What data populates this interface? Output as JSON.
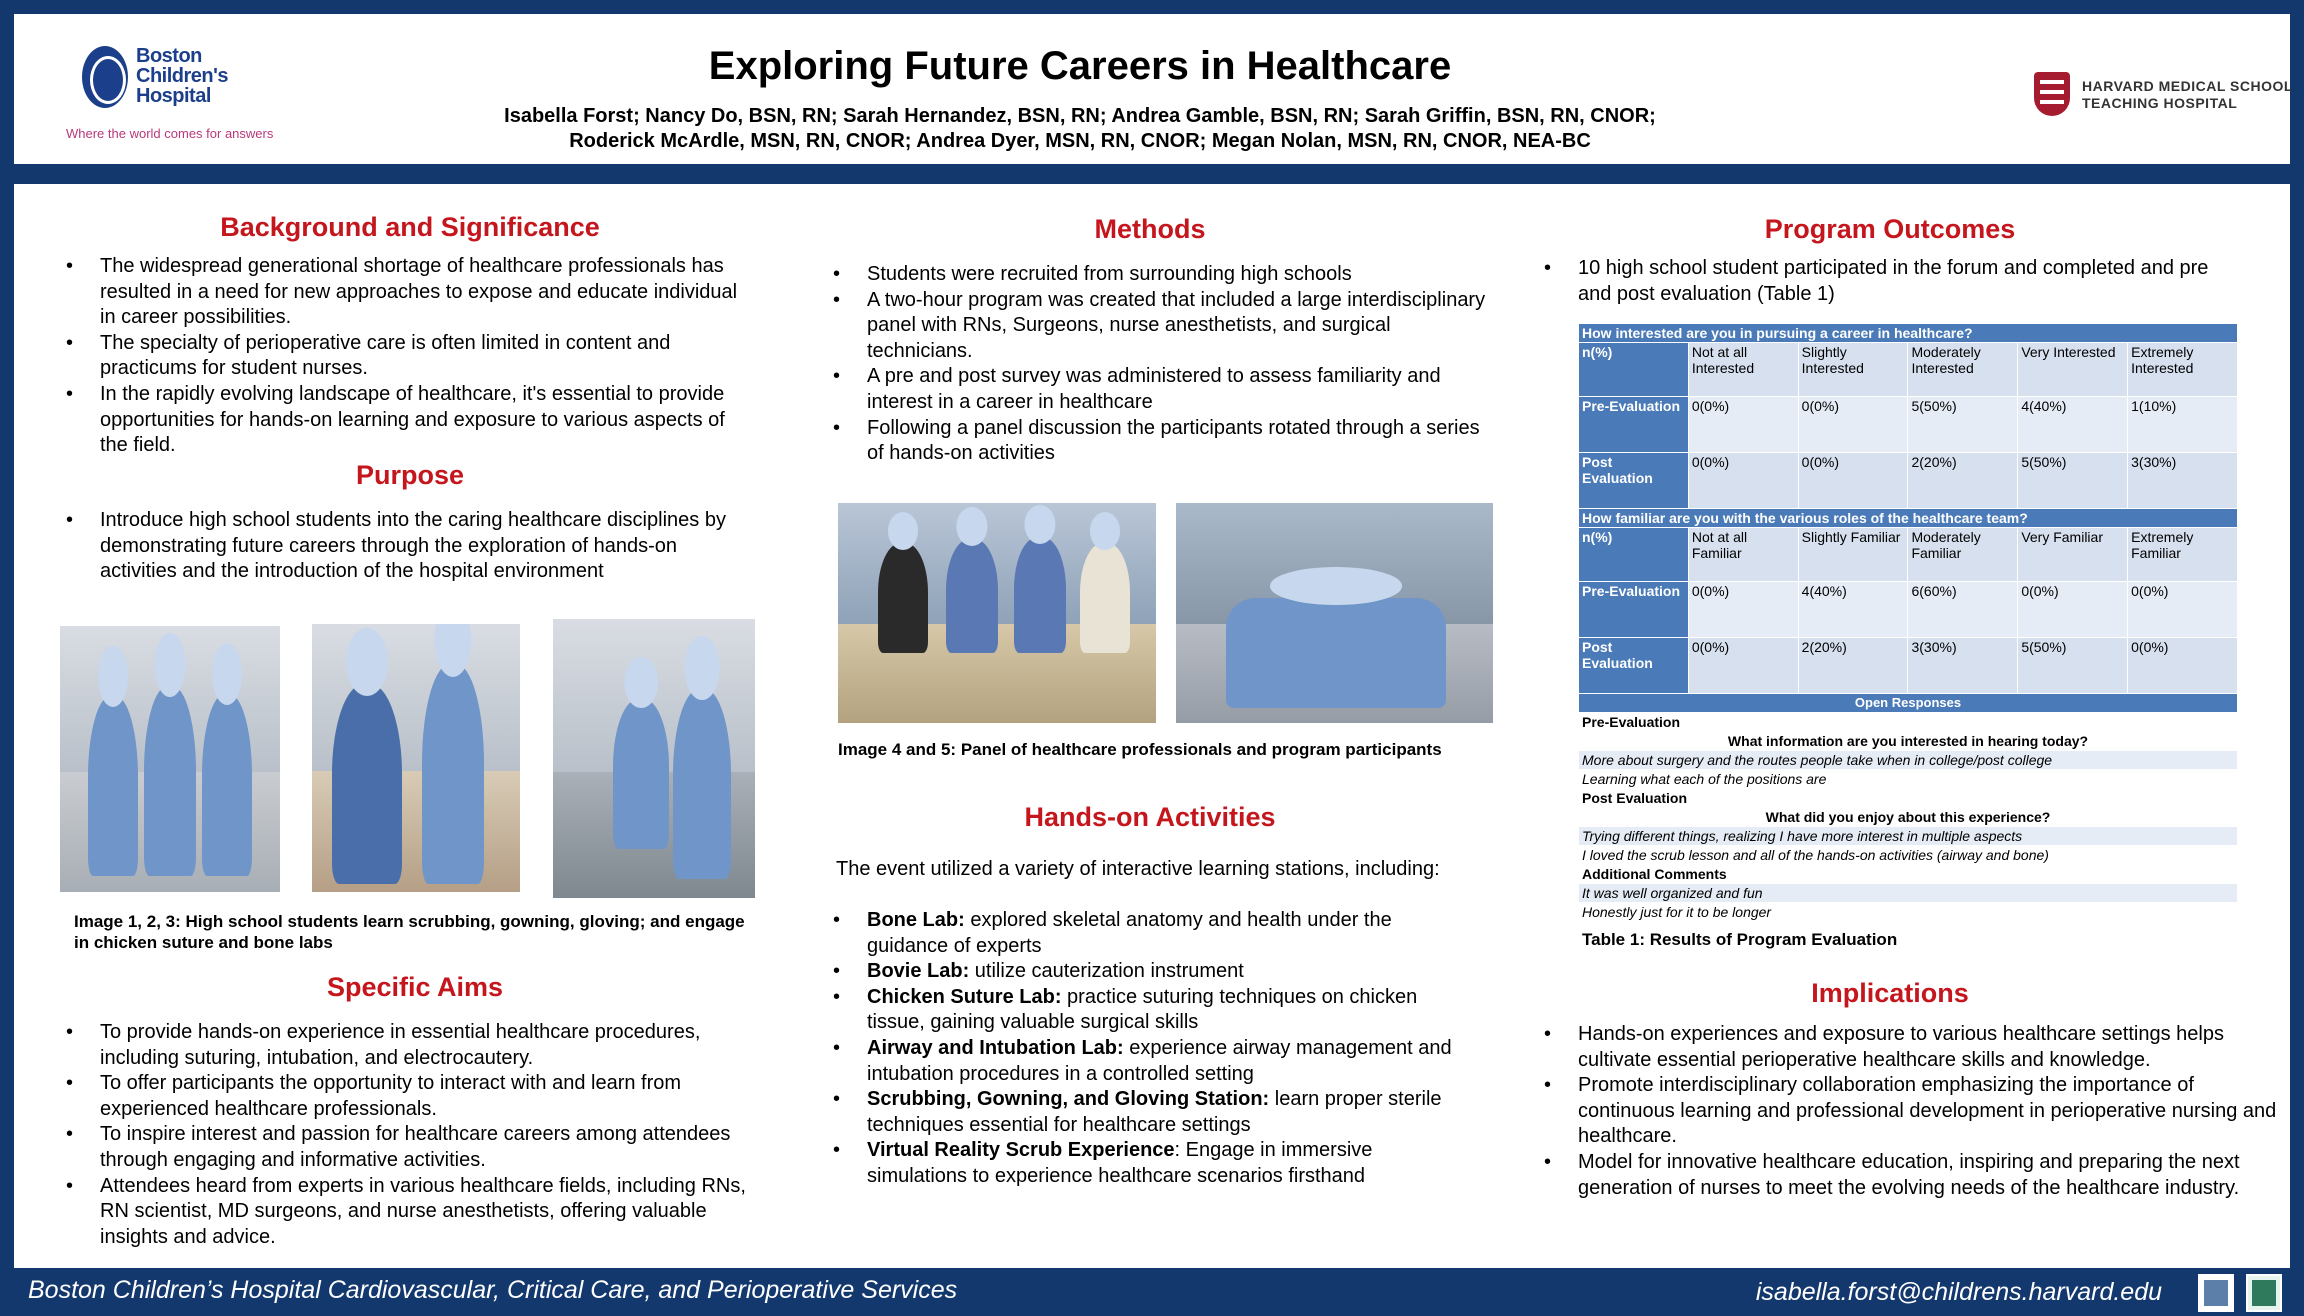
{
  "header": {
    "title": "Exploring Future Careers in Healthcare",
    "authors_line1": "Isabella Forst; Nancy Do, BSN, RN; Sarah Hernandez, BSN, RN; Andrea Gamble, BSN, RN; Sarah Griffin, BSN, RN, CNOR;",
    "authors_line2": "Roderick McArdle, MSN, RN, CNOR; Andrea Dyer, MSN, RN, CNOR; Megan Nolan, MSN, RN, CNOR, NEA-BC",
    "left_logo": {
      "line1": "Boston",
      "line2": "Children's",
      "line3": "Hospital",
      "tagline": "Where the world comes for answers"
    },
    "right_logo": {
      "line1": "HARVARD MEDICAL SCHOOL",
      "line2": "TEACHING HOSPITAL"
    }
  },
  "background": {
    "heading": "Background and Significance",
    "items": [
      "The widespread generational shortage of healthcare professionals has resulted in a need for new approaches to expose and educate individual in career possibilities.",
      "The specialty of perioperative care is often limited in content and practicums for student nurses.",
      "In the rapidly evolving landscape of healthcare, it's essential to provide opportunities for hands-on learning and exposure to various aspects of the field."
    ]
  },
  "purpose": {
    "heading": "Purpose",
    "items": [
      "Introduce high school students into the caring healthcare disciplines by demonstrating future careers through the exploration of hands-on activities and the introduction of the hospital environment"
    ]
  },
  "images_123": {
    "caption": "Image 1, 2, 3: High school students learn scrubbing, gowning, gloving; and engage in chicken suture and bone labs"
  },
  "aims": {
    "heading": "Specific Aims",
    "items": [
      "To provide hands-on experience in essential healthcare procedures, including suturing, intubation, and electrocautery.",
      "To offer participants the opportunity to interact with and learn from experienced healthcare professionals.",
      "To inspire interest and passion for healthcare careers among attendees through engaging and informative activities.",
      "Attendees heard from experts in various healthcare fields, including RNs, RN scientist, MD surgeons, and nurse anesthetists, offering valuable insights and advice."
    ]
  },
  "methods": {
    "heading": "Methods",
    "items": [
      "Students were recruited from surrounding high schools",
      "A two-hour program was created that included a large interdisciplinary panel with RNs, Surgeons, nurse anesthetists, and surgical technicians.",
      "A pre and post survey was administered to assess familiarity and interest in a career in healthcare",
      "Following a panel discussion the participants rotated through a series of hands-on activities"
    ]
  },
  "images_45": {
    "caption": "Image 4 and 5: Panel of healthcare professionals and program participants"
  },
  "hands_on": {
    "heading": "Hands-on Activities",
    "intro": "The event utilized a variety of interactive learning stations, including:",
    "items": [
      {
        "bold": "Bone Lab:",
        "text": " explored skeletal anatomy and health under the guidance of experts"
      },
      {
        "bold": "Bovie Lab:",
        "text": " utilize cauterization instrument"
      },
      {
        "bold": "Chicken Suture Lab:",
        "text": "  practice suturing techniques on chicken tissue, gaining valuable surgical skills"
      },
      {
        "bold": "Airway and Intubation Lab:",
        "text": " experience airway management and intubation procedures in a controlled setting"
      },
      {
        "bold": "Scrubbing, Gowning, and Gloving Station:",
        "text": " learn proper sterile techniques essential for healthcare settings"
      },
      {
        "bold": "Virtual Reality Scrub Experience",
        "text": ": Engage in immersive simulations to experience healthcare scenarios firsthand"
      }
    ]
  },
  "outcomes": {
    "heading": "Program Outcomes",
    "items": [
      "10 high school student participated in the forum and completed and pre and post evaluation (Table 1)"
    ],
    "table": {
      "q1": "How interested are you in pursuing a career in healthcare?",
      "q1_cols": [
        "n(%)",
        "Not at all Interested",
        "Slightly Interested",
        "Moderately Interested",
        "Very Interested",
        "Extremely Interested"
      ],
      "q1_rows": [
        {
          "label": "Pre-Evaluation",
          "values": [
            "0(0%)",
            "0(0%)",
            "5(50%)",
            "4(40%)",
            "1(10%)"
          ]
        },
        {
          "label": "Post Evaluation",
          "values": [
            "0(0%)",
            "0(0%)",
            "2(20%)",
            "5(50%)",
            "3(30%)"
          ]
        }
      ],
      "q2": "How familiar are you with the various roles of the healthcare team?",
      "q2_cols": [
        "n(%)",
        "Not at all Familiar",
        "Slightly Familiar",
        "Moderately Familiar",
        "Very Familiar",
        "Extremely Familiar"
      ],
      "q2_rows": [
        {
          "label": "Pre-Evaluation",
          "values": [
            "0(0%)",
            "4(40%)",
            "6(60%)",
            "0(0%)",
            "0(0%)"
          ]
        },
        {
          "label": "Post Evaluation",
          "values": [
            "0(0%)",
            "2(20%)",
            "3(30%)",
            "5(50%)",
            "0(0%)"
          ]
        }
      ],
      "open_title": "Open Responses",
      "pre_label": "Pre-Evaluation",
      "pre_question": "What information are you interested in hearing today?",
      "pre_answers": [
        "More about surgery and the routes people take when in college/post college",
        "Learning what each of the positions are"
      ],
      "post_label": "Post Evaluation",
      "post_question": "What did you enjoy about this experience?",
      "post_answers": [
        "Trying different things, realizing I have more interest in multiple aspects",
        "I loved the scrub lesson and all of the hands-on activities (airway and bone)"
      ],
      "comments_label": "Additional Comments",
      "comments": [
        "It was well organized and fun",
        "Honestly just for it to be longer"
      ]
    },
    "table_caption": "Table 1: Results of Program Evaluation"
  },
  "implications": {
    "heading": "Implications",
    "items": [
      "Hands-on experiences and exposure to various healthcare settings helps cultivate essential perioperative healthcare skills and knowledge.",
      "Promote interdisciplinary collaboration emphasizing the importance of continuous learning and professional development in perioperative nursing and healthcare.",
      "Model for innovative healthcare education, inspiring and preparing the next generation of nurses to meet the evolving needs of the healthcare industry."
    ]
  },
  "footer": {
    "left": "Boston Children’s Hospital Cardiovascular, Critical Care, and Perioperative Services",
    "right": "isabella.forst@childrens.harvard.edu"
  }
}
